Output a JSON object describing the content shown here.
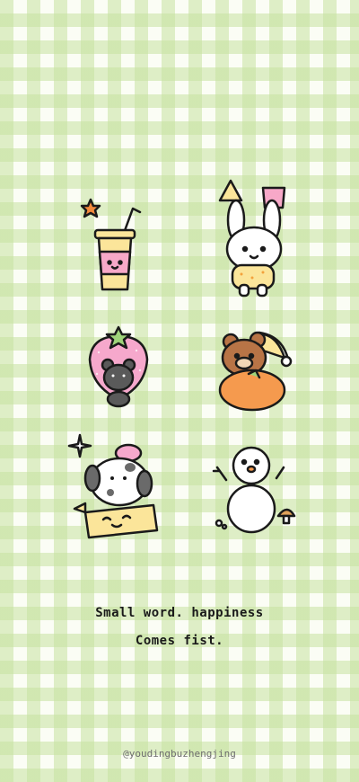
{
  "caption": {
    "line1": "Small word. happiness",
    "line2": "Comes fist."
  },
  "watermark": "@youdingbuzhengjing",
  "stickers": [
    "drink-cup",
    "bunny",
    "strawberry-bear",
    "orange-bear",
    "puppy-in-box",
    "snowman"
  ],
  "colors": {
    "gingham": "#c6e2a0",
    "background": "#fbfdf5",
    "outline": "#1a1a1a",
    "cup_yellow": "#fbe59a",
    "cup_pink": "#f7a8c8",
    "strawberry_pink": "#f6a8cc",
    "leaf_green": "#9fd47a",
    "orange": "#f59a4e",
    "bear_brown": "#b87446"
  }
}
